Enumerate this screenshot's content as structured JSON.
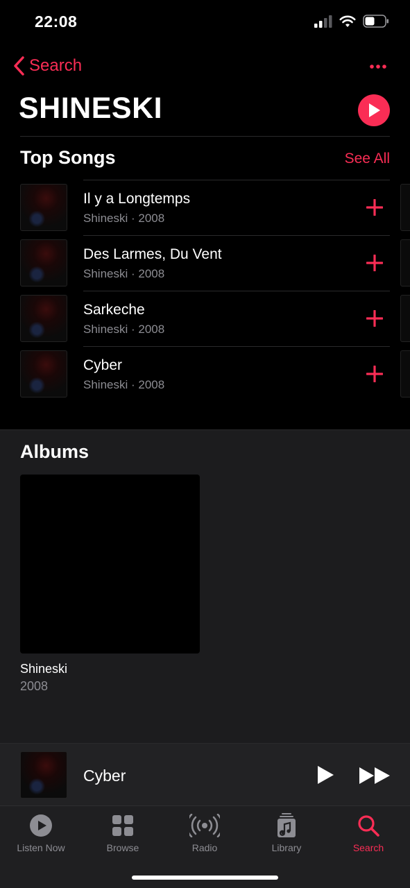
{
  "status": {
    "time": "22:08"
  },
  "nav": {
    "back_label": "Search"
  },
  "artist": {
    "name": "SHINESKI"
  },
  "top_songs": {
    "heading": "Top Songs",
    "see_all": "See All",
    "items": [
      {
        "title": "Il y a Longtemps",
        "subtitle": "Shineski · 2008"
      },
      {
        "title": "Des Larmes, Du Vent",
        "subtitle": "Shineski · 2008"
      },
      {
        "title": "Sarkeche",
        "subtitle": "Shineski · 2008"
      },
      {
        "title": "Cyber",
        "subtitle": "Shineski · 2008"
      }
    ]
  },
  "albums": {
    "heading": "Albums",
    "items": [
      {
        "title": "Shineski",
        "year": "2008"
      }
    ]
  },
  "now_playing": {
    "title": "Cyber"
  },
  "tabs": [
    {
      "label": "Listen Now",
      "icon": "listen-now-icon"
    },
    {
      "label": "Browse",
      "icon": "browse-icon"
    },
    {
      "label": "Radio",
      "icon": "radio-icon"
    },
    {
      "label": "Library",
      "icon": "library-icon"
    },
    {
      "label": "Search",
      "icon": "search-icon",
      "active": true
    }
  ],
  "colors": {
    "accent": "#fa2d55",
    "background": "#000000",
    "secondary_text": "#8d8d93"
  }
}
